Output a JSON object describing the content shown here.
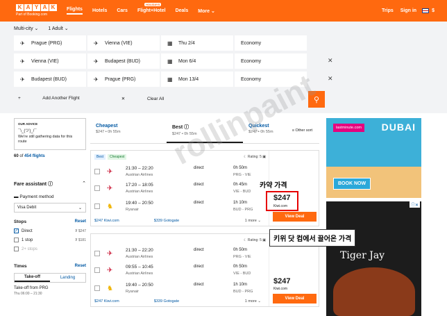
{
  "header": {
    "logo_letters": [
      "K",
      "A",
      "Y",
      "A",
      "K"
    ],
    "logo_sub": "Part of Booking.com",
    "nav": [
      "Flights",
      "Hotels",
      "Cars",
      "Flight+Hotel",
      "Deals",
      "More"
    ],
    "holiday_badge": "HOLIDAYS",
    "more_chevron": "⌄",
    "trips": "Trips",
    "signin": "Sign in",
    "currency": "$"
  },
  "search": {
    "trip_type": "Multi-city ⌄",
    "travelers": "1 Adult ⌄",
    "rows": [
      {
        "from": "Prague (PRG)",
        "to": "Vienna (VIE)",
        "date": "Thu 2/4",
        "cabin": "Economy"
      },
      {
        "from": "Vienna (VIE)",
        "to": "Budapest (BUD)",
        "date": "Mon 6/4",
        "cabin": "Economy"
      },
      {
        "from": "Budapest (BUD)",
        "to": "Prague (PRG)",
        "date": "Mon 13/4",
        "cabin": "Economy"
      }
    ],
    "add_flight": "Add Another Flight",
    "clear_all": "Clear All"
  },
  "sidebar": {
    "advice_title": "OUR ADVICE",
    "advice_emoticon": "¯\\_(ツ)_/¯",
    "advice_text": "We're still gathering data for this route",
    "count_prefix": "60",
    "count_of": "of",
    "count_total": "454 flights",
    "fare_assistant": "Fare assistant ⓘ",
    "payment_method": "Payment method",
    "payment_value": "Visa Debit",
    "stops_title": "Stops",
    "reset": "Reset",
    "stops": [
      {
        "label": "Direct",
        "price": "₮ $247",
        "checked": true
      },
      {
        "label": "1 stop",
        "price": "₮ $181",
        "checked": false
      },
      {
        "label": "2+ stops",
        "price": "",
        "checked": false
      }
    ],
    "times_title": "Times",
    "tab_takeoff": "Take-off",
    "tab_landing": "Landing",
    "takeoff_from": "Take-off from PRG",
    "takeoff_range": "Thu 06:00 – 21:30"
  },
  "sort": {
    "cheapest": {
      "label": "Cheapest",
      "sub": "$247 • 0h 55m"
    },
    "best": {
      "label": "Best ⓘ",
      "sub": "$247 • 0h 55m"
    },
    "quickest": {
      "label": "Quickest",
      "sub": "$247 • 0h 55m"
    },
    "other": "Other sort"
  },
  "results": [
    {
      "badges": [
        "Best",
        "Cheapest"
      ],
      "rating": "Rating: 5",
      "legs": [
        {
          "time": "21:30 – 22:20",
          "airline": "Austrian Airlines",
          "stops": "direct",
          "duration": "0h 50m",
          "route": "PRG - VIE",
          "logo": "austrian"
        },
        {
          "time": "17:20 – 18:05",
          "airline": "Austrian Airlines",
          "stops": "direct",
          "duration": "0h 45m",
          "route": "VIE - BUD",
          "logo": "austrian"
        },
        {
          "time": "19:40 – 20:50",
          "airline": "Ryanair",
          "stops": "direct",
          "duration": "1h 10m",
          "route": "BUD - PRG",
          "logo": "ryanair"
        }
      ],
      "kiwi": "$247 Kiwi.com",
      "gotogate": "$339 Gotogate",
      "more": "1 more ⌄",
      "price": "$247",
      "provider": "Kiwi.com",
      "deal": "View Deal"
    },
    {
      "badges": [],
      "rating": "Rating: 5",
      "legs": [
        {
          "time": "21:30 – 22:20",
          "airline": "Austrian Airlines",
          "stops": "direct",
          "duration": "0h 50m",
          "route": "PRG - VIE",
          "logo": "austrian"
        },
        {
          "time": "09:55 – 10:45",
          "airline": "Austrian Airlines",
          "stops": "direct",
          "duration": "0h 50m",
          "route": "VIE - BUD",
          "logo": "austrian"
        },
        {
          "time": "19:40 – 20:50",
          "airline": "Ryanair",
          "stops": "direct",
          "duration": "1h 10m",
          "route": "BUD - PRG",
          "logo": "ryanair"
        }
      ],
      "kiwi": "$247 Kiwi.com",
      "gotogate": "$339 Gotogate",
      "more": "1 more ⌄",
      "price": "$247",
      "provider": "Kiwi.com",
      "deal": "View Deal"
    }
  ],
  "annotations": {
    "kayak_price": "카약 가격",
    "kiwi_note": "키위 닷 컴에서 끌어온 가격",
    "watermark": "rollinpaint"
  },
  "ads": {
    "ad1_brand": "lastminute.com",
    "ad1_title": "DUBAI",
    "ad1_cta": "BOOK NOW",
    "ad2_title": "Tiger Jay",
    "ad2_close": "ⓘ✕"
  },
  "colors": {
    "accent": "#ff690f",
    "link": "#0058a3",
    "annotation": "#e60000"
  }
}
